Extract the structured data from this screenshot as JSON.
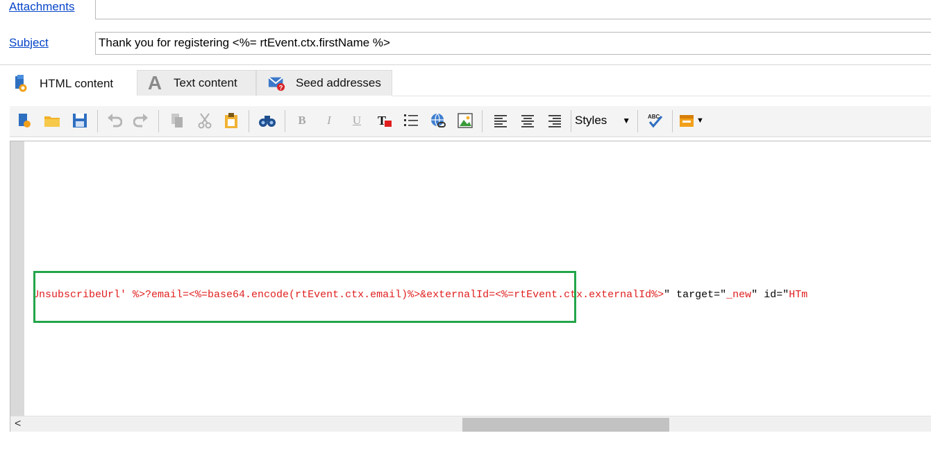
{
  "header": {
    "attachments_label": "Attachments",
    "subject_label": "Subject",
    "subject_value": "Thank you for registering <%= rtEvent.ctx.firstName %>"
  },
  "tabs": [
    {
      "label": "HTML content",
      "icon": "html-page-icon"
    },
    {
      "label": "Text content",
      "icon": "letter-a-icon"
    },
    {
      "label": "Seed addresses",
      "icon": "envelope-question-icon"
    }
  ],
  "toolbar": {
    "styles_label": "Styles",
    "bold": "B",
    "italic": "I",
    "underline": "U",
    "spell_label": "ABC"
  },
  "editor": {
    "code": {
      "part1": "UnsubscribeUrl' %>?email=<%=base64.encode(rtEvent.ctx.email)%>&externalId=<%=rtEvent.ctx.externalId%>",
      "part2": "\" target=\"",
      "part3": "_new",
      "part4": "\" id=\"",
      "part5": "HTm"
    }
  },
  "colors": {
    "link": "#0645c8",
    "code_highlight": "#e01e1e",
    "annotation_box": "#23a54a"
  }
}
